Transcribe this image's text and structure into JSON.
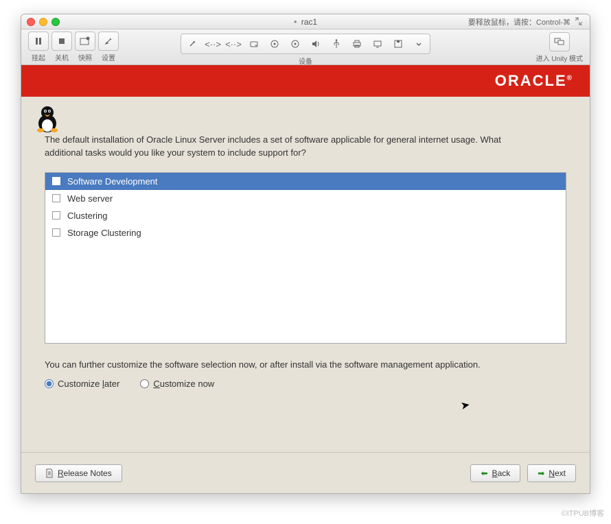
{
  "titlebar": {
    "title": "rac1",
    "hint": "要释放鼠标，请按：Control-⌘"
  },
  "toolbar": {
    "suspend": "挂起",
    "poweroff": "关机",
    "snapshot": "快照",
    "settings": "设置",
    "devices": "设备",
    "unity": "进入 Unity 模式"
  },
  "oracle": {
    "brand": "ORACLE"
  },
  "intro": "The default installation of Oracle Linux Server includes a set of software applicable for general internet usage. What additional tasks would you like your system to include support for?",
  "options": [
    {
      "label": "Software Development",
      "checked": true,
      "selected": true
    },
    {
      "label": "Web server",
      "checked": false,
      "selected": false
    },
    {
      "label": "Clustering",
      "checked": false,
      "selected": false
    },
    {
      "label": "Storage Clustering",
      "checked": false,
      "selected": false
    }
  ],
  "below": "You can further customize the software selection now, or after install via the software management application.",
  "radios": {
    "later": "Customize later",
    "now": "Customize now",
    "selected": "later"
  },
  "buttons": {
    "release": "Release Notes",
    "back": "Back",
    "next": "Next"
  },
  "watermark": "©ITPUB博客"
}
